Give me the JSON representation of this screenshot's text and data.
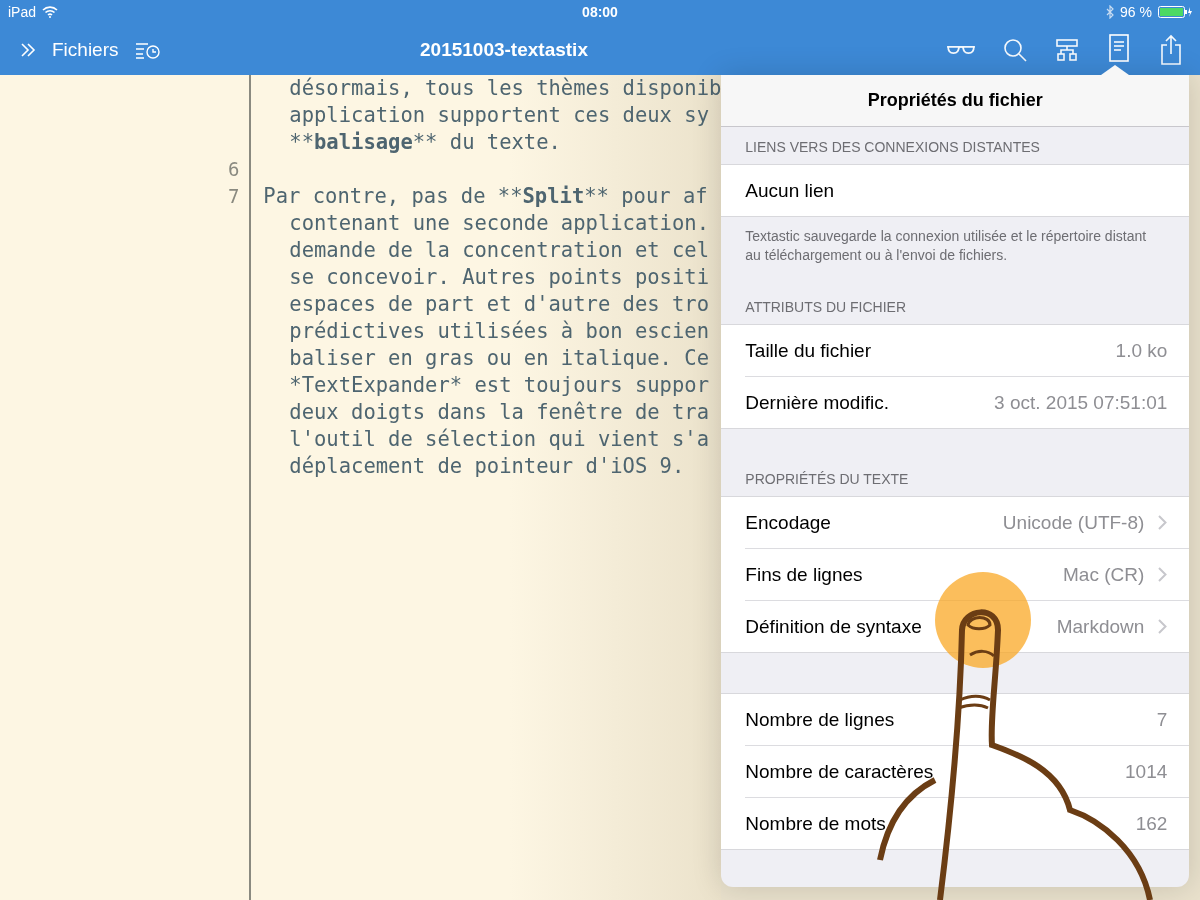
{
  "status_bar": {
    "device": "iPad",
    "time": "08:00",
    "battery": "96 %"
  },
  "nav_bar": {
    "back_label": "Fichiers",
    "title": "20151003-textastix"
  },
  "toolbar_icons": [
    {
      "kind": "glasses",
      "selected": false
    },
    {
      "kind": "search",
      "selected": false
    },
    {
      "kind": "structure",
      "selected": false
    },
    {
      "kind": "document",
      "selected": true
    },
    {
      "kind": "share",
      "selected": false
    }
  ],
  "code_lines": [
    {
      "rows": [
        [
          {
            "text": "désormais, tous les thèmes disponib",
            "bold": false
          }
        ],
        [
          {
            "text": "application supportent ces deux sy",
            "bold": false
          }
        ],
        [
          {
            "text": "**",
            "bold": false
          },
          {
            "text": "balisage",
            "bold": true
          },
          {
            "text": "** du texte.",
            "bold": false
          }
        ]
      ]
    },
    {
      "number": "6"
    },
    {
      "number": "7",
      "rows": [
        [
          {
            "text": "Par contre, pas de **",
            "bold": false
          },
          {
            "text": "Split",
            "bold": true
          },
          {
            "text": "** pour af",
            "bold": false
          }
        ],
        [
          {
            "text": "contenant une seconde application.",
            "bold": false
          }
        ],
        [
          {
            "text": "demande de la concentration et cel",
            "bold": false
          }
        ],
        [
          {
            "text": "se concevoir. Autres points positi",
            "bold": false
          }
        ],
        [
          {
            "text": "espaces de part et d'autre des tro",
            "bold": false
          }
        ],
        [
          {
            "text": "prédictives utilisées à bon escien",
            "bold": false
          }
        ],
        [
          {
            "text": "baliser en gras ou en italique. Ce",
            "bold": false
          }
        ],
        [
          {
            "text": "*TextExpander* est toujours suppor",
            "bold": false
          }
        ],
        [
          {
            "text": "deux doigts dans la fenêtre de tra",
            "bold": false
          }
        ],
        [
          {
            "text": "l'outil de sélection qui vient s'a",
            "bold": false
          }
        ],
        [
          {
            "text": "déplacement de pointeur d'iOS 9.",
            "bold": false
          }
        ]
      ]
    }
  ],
  "popover": {
    "title": "Propriétés du fichier",
    "sections": [
      {
        "header": "LIENS VERS DES CONNEXIONS DISTANTES",
        "rows": [
          {
            "label": "Aucun lien",
            "chevron": false
          }
        ],
        "footer": "Textastic sauvegarde la connexion utilisée et le répertoire distant au téléchargement ou à l'envoi de fichiers."
      },
      {
        "header": "ATTRIBUTS DU FICHIER",
        "rows": [
          {
            "label": "Taille du fichier",
            "value": "1.0 ko",
            "chevron": false
          },
          {
            "label": "Dernière modific.",
            "value": "3 oct. 2015 07:51:01",
            "chevron": false
          }
        ]
      },
      {
        "header": "PROPRIÉTÉS DU TEXTE",
        "rows": [
          {
            "label": "Encodage",
            "value": "Unicode (UTF-8)",
            "chevron": true
          },
          {
            "label": "Fins de lignes",
            "value": "Mac (CR)",
            "chevron": true
          },
          {
            "label": "Définition de syntaxe",
            "value": "Markdown",
            "chevron": true
          }
        ]
      },
      {
        "rows": [
          {
            "label": "Nombre de lignes",
            "value": "7",
            "chevron": false
          },
          {
            "label": "Nombre de caractères",
            "value": "1014",
            "chevron": false
          },
          {
            "label": "Nombre de mots",
            "value": "162",
            "chevron": false
          }
        ]
      }
    ]
  }
}
